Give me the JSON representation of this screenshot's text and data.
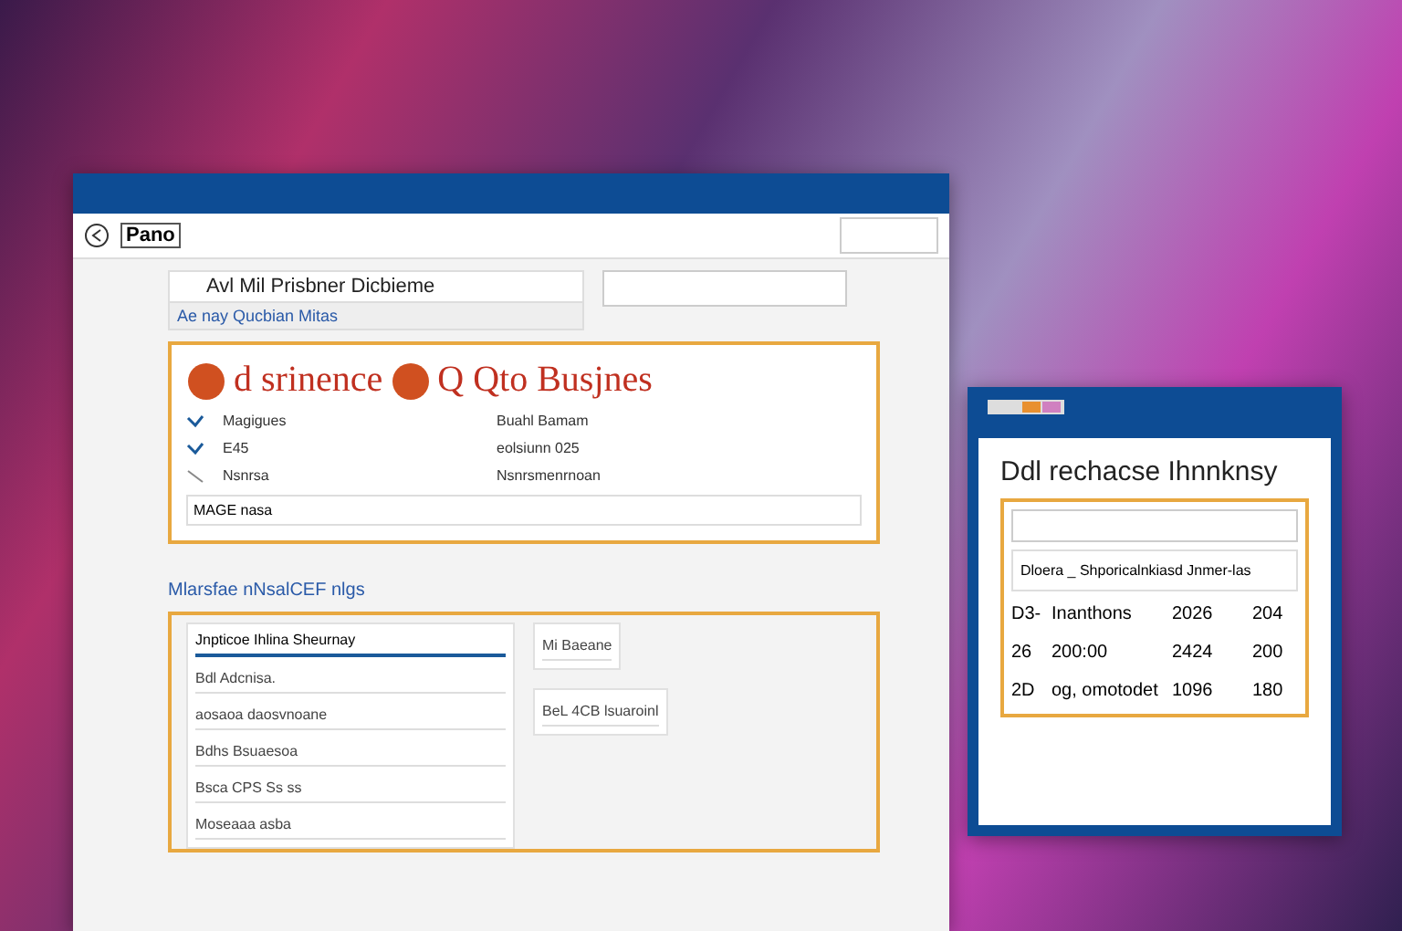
{
  "main_window": {
    "address": "Pano",
    "heading": "Avl Mil Prisbner Dicbieme",
    "subheading": "Ae nay Qucbian Mitas",
    "banner": {
      "left": "d srinence",
      "right": "Q Qto Busjnes"
    },
    "info_rows": [
      {
        "label": "Magigues",
        "value": "Buahl Bamam",
        "checked": true
      },
      {
        "label": "E45",
        "value": "eolsiunn 025",
        "checked": true
      },
      {
        "label": "Nsnrsa",
        "value": "Nsnrsmenrnoan",
        "checked": false
      }
    ],
    "note": "MAGE nasa",
    "section_title": "Mlarsfae nNsalCEF nlgs",
    "list_card": {
      "title": "Jnpticoe Ihlina Sheurnay",
      "items": [
        "Bdl Adcnisa.",
        "aosaoa daosvnoane",
        "Bdhs Bsuaesoa",
        "Bsca CPS Ss ss",
        "Moseaaa asba"
      ]
    },
    "side_cards": [
      "Mi Baeane",
      "BeL 4CB lsuaroinl"
    ]
  },
  "side_window": {
    "heading": "Ddl rechacse Ihnnknsy",
    "caption": "Dloera _ Shporicalnkiasd Jnmer-las",
    "rows": [
      [
        "D3-",
        "Inanthons",
        "2026",
        "204"
      ],
      [
        "26",
        "200:00",
        "2424",
        "200"
      ],
      [
        "2D",
        "og, omotodet",
        "1096",
        "180"
      ]
    ]
  }
}
